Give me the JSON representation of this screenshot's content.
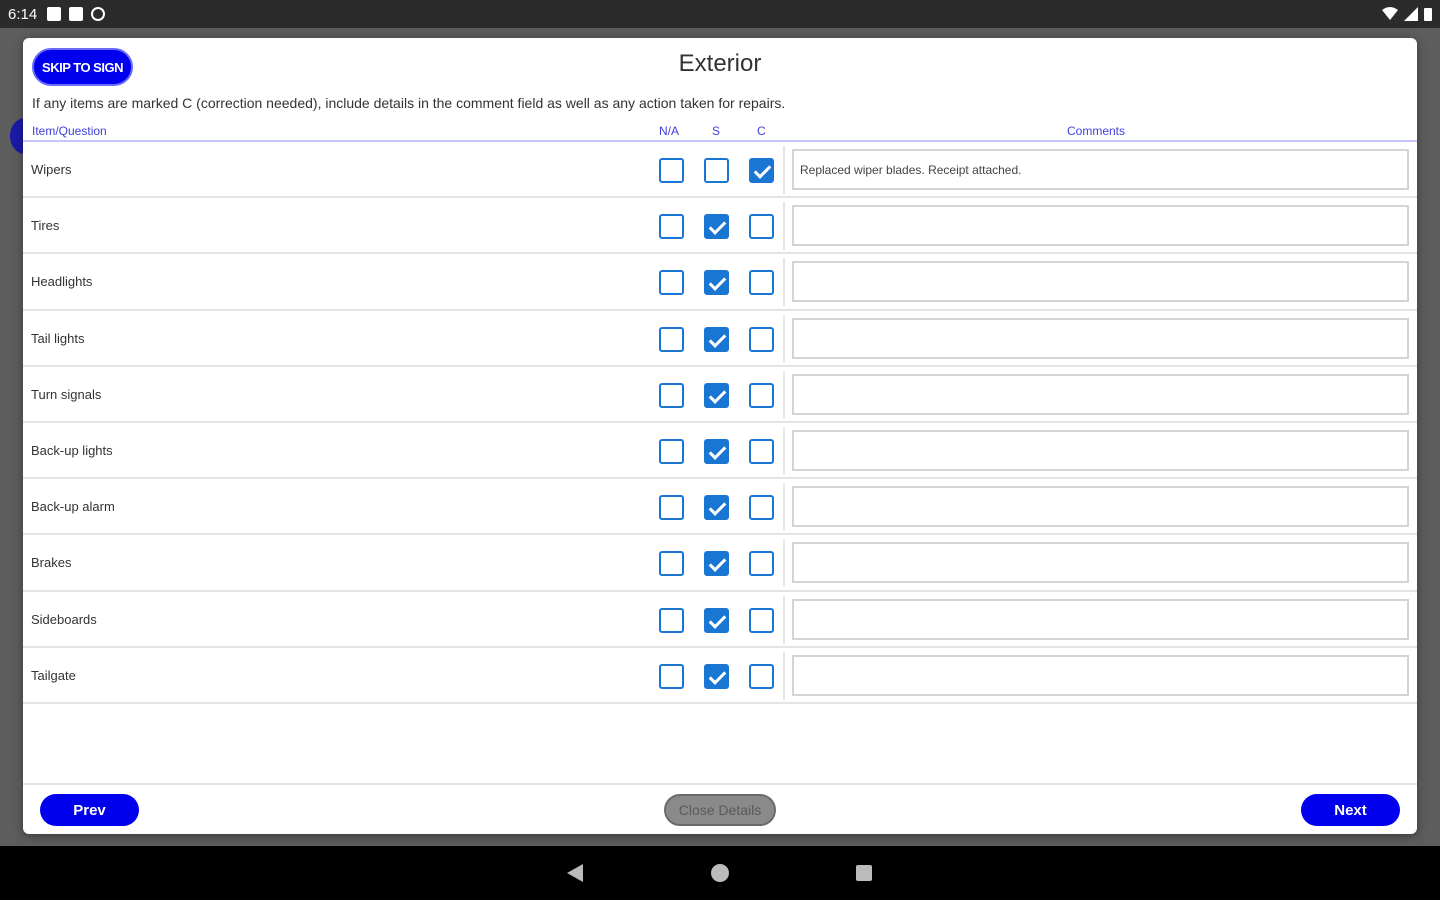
{
  "status_bar": {
    "time": "6:14"
  },
  "dialog": {
    "skip_button": "SKIP TO SIGN",
    "title": "Exterior",
    "instructions": "If any items are marked C (correction needed), include details in the comment field as well as any action taken for repairs.",
    "headers": {
      "item": "Item/Question",
      "na": "N/A",
      "s": "S",
      "c": "C",
      "comments": "Comments"
    },
    "rows": [
      {
        "label": "Wipers",
        "na": false,
        "s": false,
        "c": true,
        "comment": "Replaced wiper blades. Receipt attached."
      },
      {
        "label": "Tires",
        "na": false,
        "s": true,
        "c": false,
        "comment": ""
      },
      {
        "label": "Headlights",
        "na": false,
        "s": true,
        "c": false,
        "comment": ""
      },
      {
        "label": "Tail lights",
        "na": false,
        "s": true,
        "c": false,
        "comment": ""
      },
      {
        "label": "Turn signals",
        "na": false,
        "s": true,
        "c": false,
        "comment": ""
      },
      {
        "label": "Back-up lights",
        "na": false,
        "s": true,
        "c": false,
        "comment": ""
      },
      {
        "label": "Back-up alarm",
        "na": false,
        "s": true,
        "c": false,
        "comment": ""
      },
      {
        "label": "Brakes",
        "na": false,
        "s": true,
        "c": false,
        "comment": ""
      },
      {
        "label": "Sideboards",
        "na": false,
        "s": true,
        "c": false,
        "comment": ""
      },
      {
        "label": "Tailgate",
        "na": false,
        "s": true,
        "c": false,
        "comment": ""
      }
    ],
    "footer": {
      "prev": "Prev",
      "close": "Close Details",
      "next": "Next"
    }
  },
  "colors": {
    "primary": "#0000ee",
    "checkbox": "#1976d2",
    "header_text": "#4040dd"
  }
}
